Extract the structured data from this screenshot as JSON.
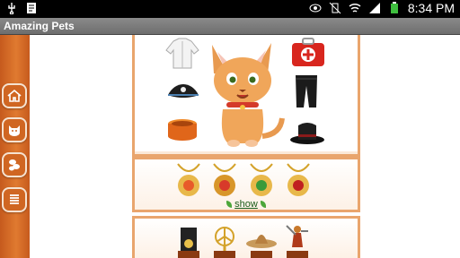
{
  "status_bar": {
    "time": "8:34 PM",
    "icons": [
      "usb-icon",
      "notes-icon",
      "eye-icon",
      "no-vibrate-icon",
      "wifi-icon",
      "signal-icon",
      "battery-icon"
    ]
  },
  "app": {
    "title": "Amazing Pets"
  },
  "sidebar": {
    "items": [
      {
        "name": "home",
        "icon": "home-icon"
      },
      {
        "name": "pet",
        "icon": "cat-face-icon"
      },
      {
        "name": "coins",
        "icon": "coins-icon"
      },
      {
        "name": "menu",
        "icon": "list-icon"
      }
    ]
  },
  "pet_panel": {
    "pet": "cat-icon",
    "left_items": [
      "white-jacket-icon",
      "pirate-hat-icon",
      "food-bowl-icon"
    ],
    "right_items": [
      "first-aid-kit-icon",
      "black-pants-icon",
      "black-hat-icon"
    ]
  },
  "amulets": {
    "items": [
      "amulet-1-icon",
      "amulet-2-icon",
      "amulet-3-icon",
      "amulet-4-icon"
    ],
    "show_label": "show"
  },
  "trophies": {
    "items": [
      "trophy-box-icon",
      "trophy-star-icon",
      "trophy-sombrero-icon",
      "trophy-gladiator-icon"
    ]
  },
  "colors": {
    "sidebar": "#d06622",
    "panel_border": "#e9a56d",
    "link": "#1a5d1a"
  }
}
